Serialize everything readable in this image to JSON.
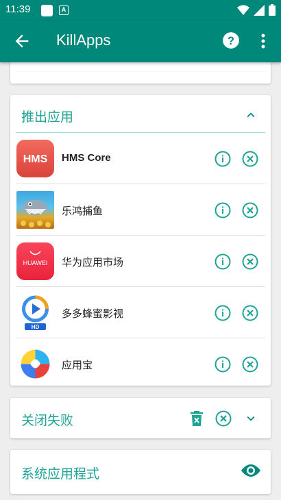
{
  "status_bar": {
    "time": "11:39",
    "notif_icon_letter": "A"
  },
  "app_bar": {
    "title": "KillApps"
  },
  "eject_section": {
    "title": "推出应用",
    "apps": [
      {
        "name": "HMS Core",
        "icon": "hms-core-icon",
        "icon_text": "HMS"
      },
      {
        "name": "乐鸿捕鱼",
        "icon": "fishing-game-icon"
      },
      {
        "name": "华为应用市场",
        "icon": "huawei-appgallery-icon",
        "icon_text": "HUAWEI"
      },
      {
        "name": "多多蜂蜜影视",
        "icon": "video-player-icon",
        "icon_text": "HD"
      },
      {
        "name": "应用宝",
        "icon": "yingyongbao-icon"
      }
    ]
  },
  "failed_section": {
    "title": "关闭失败"
  },
  "system_section": {
    "title": "系统应用程式"
  },
  "colors": {
    "primary": "#00897b",
    "accent": "#1ea395"
  }
}
